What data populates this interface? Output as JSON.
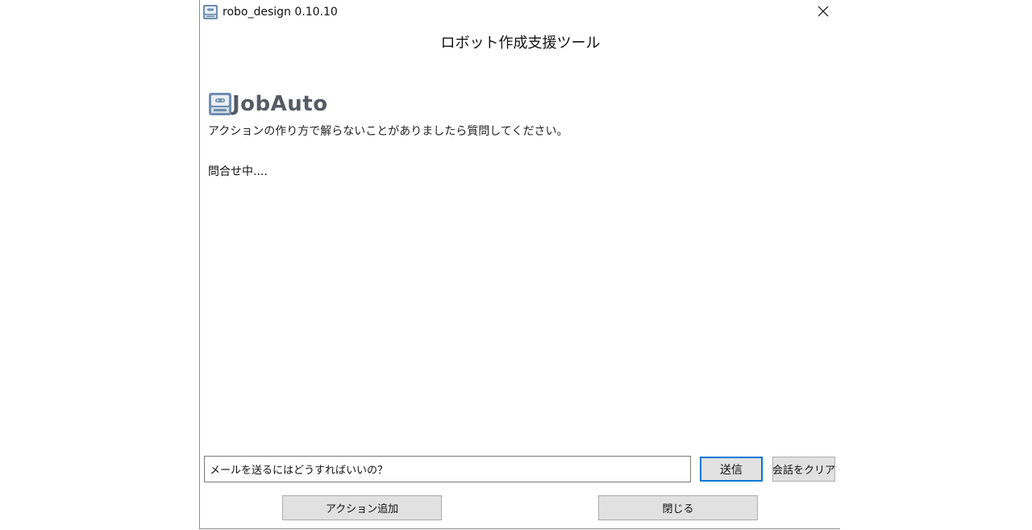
{
  "window": {
    "title": "robo_design 0.10.10"
  },
  "dialog": {
    "heading": "ロボット作成支援ツール",
    "logo_text": "JobAuto",
    "intro": "アクションの作り方で解らないことがありましたら質問してください。",
    "status": "問合せ中...."
  },
  "input": {
    "value": "メールを送るにはどうすればいいの？"
  },
  "buttons": {
    "send": "送信",
    "clear": "会話をクリア",
    "add_action": "アクション追加",
    "close": "閉じる"
  },
  "icons": {
    "app": "robot-icon",
    "close": "close-icon",
    "logo": "robot-logo-icon"
  },
  "colors": {
    "accent": "#0078d7",
    "button_bg": "#e1e1e1",
    "logo_text": "#555a63"
  }
}
